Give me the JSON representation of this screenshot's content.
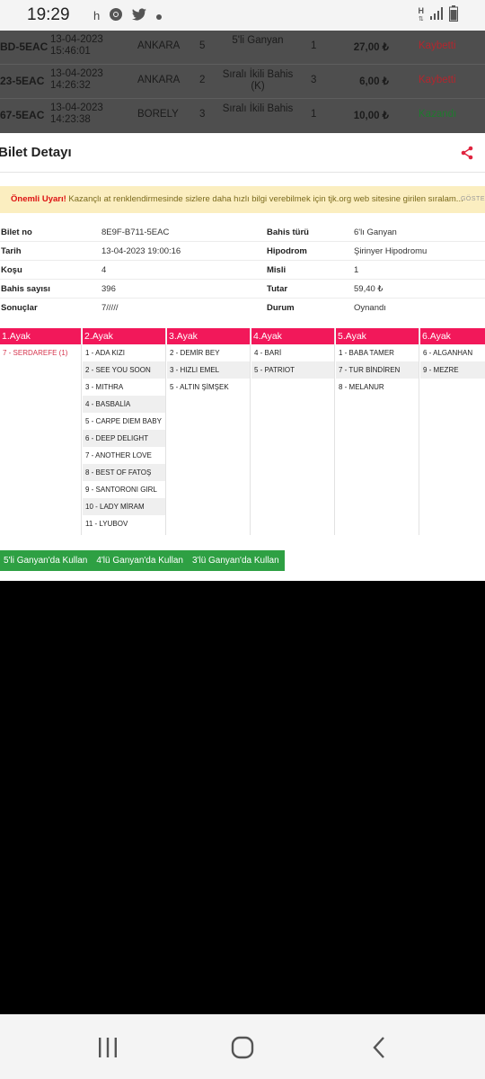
{
  "status_bar": {
    "time": "19:29",
    "left_icons": [
      "h",
      "chrome-icon",
      "twitter-icon",
      "dot-icon"
    ],
    "right_icons": [
      "data-arrows-icon",
      "signal-icon",
      "battery-icon"
    ],
    "data_label": "H"
  },
  "background_rows": [
    {
      "id": "BD-5EAC",
      "date": "13-04-2023",
      "time": "15:46:01",
      "place": "ANKARA",
      "leg": "5",
      "type": "5'li Ganyan",
      "count": "1",
      "amount": "27,00 ₺",
      "result": "Kaybetti"
    },
    {
      "id": "23-5EAC",
      "date": "13-04-2023",
      "time": "14:26:32",
      "place": "ANKARA",
      "leg": "2",
      "type": "Sıralı İkili Bahis (K)",
      "count": "3",
      "amount": "6,00 ₺",
      "result": "Kaybetti"
    },
    {
      "id": "67-5EAC",
      "date": "13-04-2023",
      "time": "14:23:38",
      "place": "BORELY",
      "leg": "3",
      "type": "Sıralı İkili Bahis",
      "count": "1",
      "amount": "10,00 ₺",
      "result": "Kazandı"
    }
  ],
  "modal": {
    "title": "Bilet Detayı",
    "warning": {
      "strong": "Önemli Uyarı!",
      "text": " Kazançlı at renklendirmesinde sizlere daha hızlı bilgi verebilmek için tjk.org web sitesine girilen sıralam...",
      "more": "GÖSTE"
    },
    "info": [
      {
        "k1": "Bilet no",
        "v1": "8E9F-B711-5EAC",
        "k2": "Bahis türü",
        "v2": "6'lı Ganyan"
      },
      {
        "k1": "Tarih",
        "v1": "13-04-2023 19:00:16",
        "k2": "Hipodrom",
        "v2": "Şirinyer Hipodromu"
      },
      {
        "k1": "Koşu",
        "v1": "4",
        "k2": "Misli",
        "v2": "1"
      },
      {
        "k1": "Bahis sayısı",
        "v1": "396",
        "k2": "Tutar",
        "v2": "59,40 ₺"
      },
      {
        "k1": "Sonuçlar",
        "v1": "7/////",
        "k2": "Durum",
        "v2": "Oynandı"
      }
    ],
    "legs": [
      {
        "title": "1.Ayak",
        "items": [
          "7 - SERDAREFE (1)"
        ]
      },
      {
        "title": "2.Ayak",
        "items": [
          "1 - ADA KIZI",
          "2 - SEE YOU SOON",
          "3 - MITHRA",
          "4 - BASBALİA",
          "5 - CARPE DIEM BABY",
          "6 - DEEP DELIGHT",
          "7 - ANOTHER LOVE",
          "8 - BEST OF FATOŞ",
          "9 - SANTORONI GIRL",
          "10 - LADY MİRAM",
          "11 - LYUBOV"
        ]
      },
      {
        "title": "3.Ayak",
        "items": [
          "2 - DEMİR BEY",
          "3 - HIZLI EMEL",
          "5 - ALTIN ŞİMŞEK"
        ]
      },
      {
        "title": "4.Ayak",
        "items": [
          "4 - BARİ",
          "5 - PATRIOT"
        ]
      },
      {
        "title": "5.Ayak",
        "items": [
          "1 - BABA TAMER",
          "7 - TUR BİNDİREN",
          "8 - MELANUR"
        ]
      },
      {
        "title": "6.Ayak",
        "items": [
          "6 - ALGANHAN",
          "9 - MEZRE"
        ]
      }
    ],
    "buttons": [
      "5'li Ganyan'da Kullan",
      "4'lü Ganyan'da Kullan",
      "3'lü Ganyan'da Kullan"
    ]
  },
  "colors": {
    "leg_header": "#f2185a",
    "button": "#2ea043",
    "lost": "#b3262e",
    "won": "#1f7a2e",
    "warning_bg": "#fbeec0"
  }
}
